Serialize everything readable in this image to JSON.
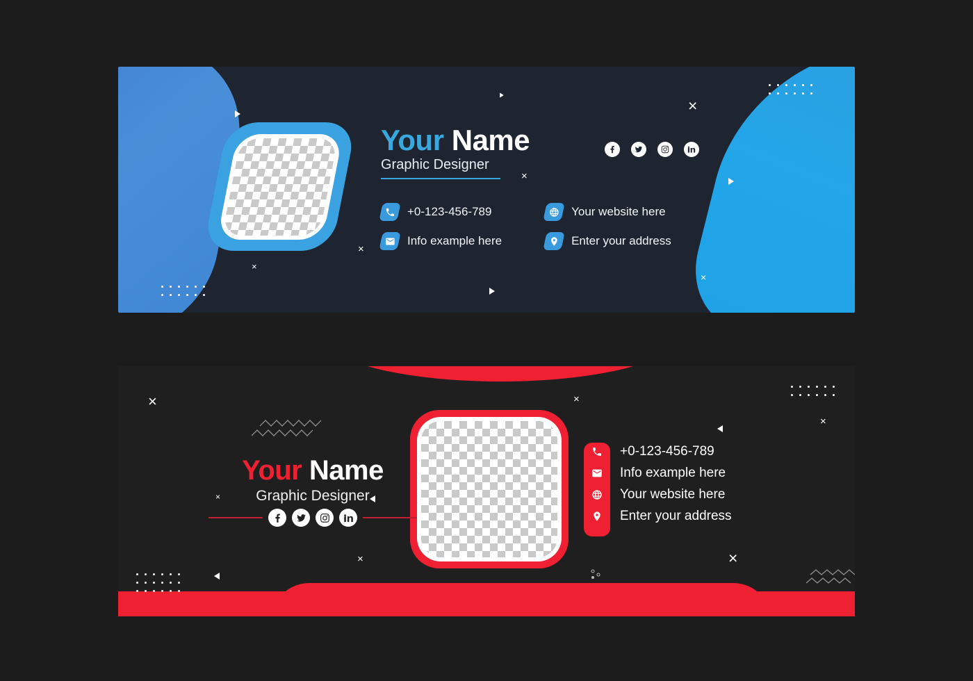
{
  "page": {
    "background_color": "#1c1c1c",
    "title": "Email Signature / Social Media Banner Templates"
  },
  "banners": [
    {
      "id": "blue-banner",
      "theme": "blue",
      "colors": {
        "background": "#1e2430",
        "accent": "#3aa8e0",
        "accent_left_shape": "#4a8ed8",
        "accent_right_shape": "#23a6e8"
      },
      "name": {
        "first": "Your",
        "last": "Name"
      },
      "role": "Graphic Designer",
      "photo_placeholder": "checkerboard-transparent",
      "social": [
        {
          "icon": "facebook-icon",
          "label": "Facebook"
        },
        {
          "icon": "twitter-icon",
          "label": "Twitter"
        },
        {
          "icon": "instagram-icon",
          "label": "Instagram"
        },
        {
          "icon": "linkedin-icon",
          "label": "LinkedIn"
        }
      ],
      "contact_left": [
        {
          "icon": "phone-icon",
          "text": "+0-123-456-789"
        },
        {
          "icon": "envelope-icon",
          "text": "Info example here"
        }
      ],
      "contact_right": [
        {
          "icon": "globe-icon",
          "text": "Your website here"
        },
        {
          "icon": "map-pin-icon",
          "text": "Enter your address"
        }
      ]
    },
    {
      "id": "red-banner",
      "theme": "red",
      "colors": {
        "background": "#1f1f1f",
        "accent": "#ef2032",
        "line": "#c2202f"
      },
      "name": {
        "first": "Your",
        "last": "Name"
      },
      "role": "Graphic Designer",
      "photo_placeholder": "checkerboard-transparent",
      "social": [
        {
          "icon": "facebook-icon",
          "label": "Facebook"
        },
        {
          "icon": "twitter-icon",
          "label": "Twitter"
        },
        {
          "icon": "instagram-icon",
          "label": "Instagram"
        },
        {
          "icon": "linkedin-icon",
          "label": "LinkedIn"
        }
      ],
      "contact": [
        {
          "icon": "phone-icon",
          "text": "+0-123-456-789"
        },
        {
          "icon": "envelope-icon",
          "text": "Info example here"
        },
        {
          "icon": "globe-icon",
          "text": "Your website here"
        },
        {
          "icon": "map-pin-icon",
          "text": "Enter your address"
        }
      ]
    }
  ],
  "decorations": {
    "cross": "×",
    "triangle_right": "triangle-right-icon",
    "triangle_left": "triangle-left-icon",
    "dot_grid": "dot-grid-icon",
    "zigzag": "zigzag-icon"
  }
}
